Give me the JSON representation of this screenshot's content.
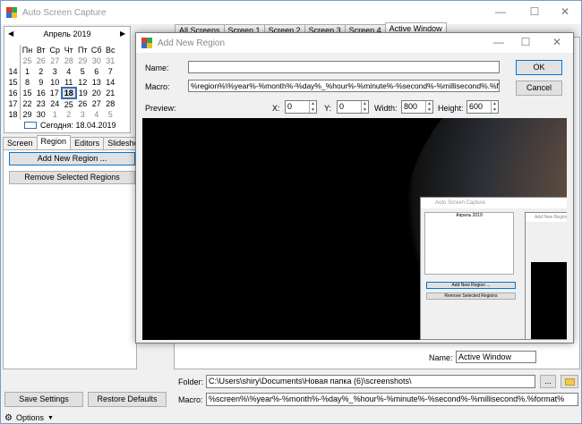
{
  "app": {
    "title": "Auto Screen Capture"
  },
  "calendar": {
    "month_label": "Апрель 2019",
    "weekdays": [
      "Пн",
      "Вт",
      "Ср",
      "Чт",
      "Пт",
      "Сб",
      "Вс"
    ],
    "weeks": [
      {
        "wk": "",
        "days": [
          "25",
          "26",
          "27",
          "28",
          "29",
          "30",
          "31"
        ]
      },
      {
        "wk": "14",
        "days": [
          "1",
          "2",
          "3",
          "4",
          "5",
          "6",
          "7"
        ]
      },
      {
        "wk": "15",
        "days": [
          "8",
          "9",
          "10",
          "11",
          "12",
          "13",
          "14"
        ]
      },
      {
        "wk": "16",
        "days": [
          "15",
          "16",
          "17",
          "18",
          "19",
          "20",
          "21"
        ]
      },
      {
        "wk": "17",
        "days": [
          "22",
          "23",
          "24",
          "25",
          "26",
          "27",
          "28"
        ]
      },
      {
        "wk": "18",
        "days": [
          "29",
          "30",
          "1",
          "2",
          "3",
          "4",
          "5"
        ]
      }
    ],
    "today_label": "Сегодня: 18.04.2019"
  },
  "left_tabs": [
    "Screen",
    "Region",
    "Editors",
    "Slideshow"
  ],
  "buttons": {
    "add_region": "Add New Region ...",
    "remove_regions": "Remove Selected Regions",
    "save_settings": "Save Settings",
    "restore_defaults": "Restore Defaults",
    "ok": "OK",
    "cancel": "Cancel",
    "browse": "..."
  },
  "main_tabs": [
    "All Screens",
    "Screen 1",
    "Screen 2",
    "Screen 3",
    "Screen 4",
    "Active Window"
  ],
  "dialog": {
    "title": "Add New Region",
    "name_label": "Name:",
    "name_value": "",
    "macro_label": "Macro:",
    "macro_value": "%region%\\%year%-%month%-%day%_%hour%-%minute%-%second%-%millisecond%.%format%",
    "preview_label": "Preview:",
    "x_label": "X:",
    "x_value": "0",
    "y_label": "Y:",
    "y_value": "0",
    "width_label": "Width:",
    "width_value": "800",
    "height_label": "Height:",
    "height_value": "600"
  },
  "bottom": {
    "name_label": "Name:",
    "name_value": "Active Window",
    "folder_label": "Folder:",
    "folder_value": "C:\\Users\\shiry\\Documents\\Новая папка (6)\\screenshots\\",
    "macro_label": "Macro:",
    "macro_value": "%screen%\\%year%-%month%-%day%_%hour%-%minute%-%second%-%millisecond%.%format%"
  },
  "status": {
    "options_label": "Options"
  },
  "colors": {
    "accent": "#0078d7",
    "selected_day": "#3a6ea5"
  }
}
